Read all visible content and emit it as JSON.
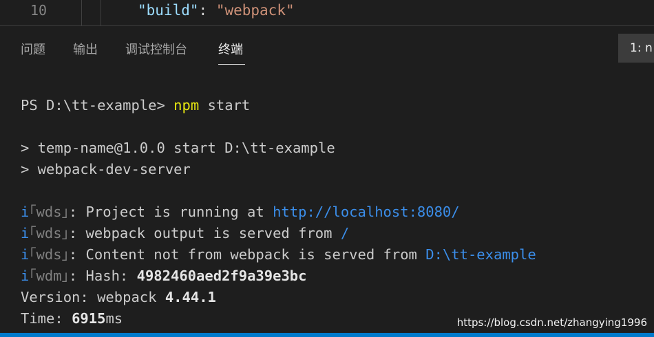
{
  "editor": {
    "line_number": "10",
    "code": {
      "key": "\"build\"",
      "colon": ": ",
      "value": "\"webpack\""
    }
  },
  "panel": {
    "tabs": [
      {
        "label": "问题"
      },
      {
        "label": "输出"
      },
      {
        "label": "调试控制台"
      },
      {
        "label": "终端",
        "active": true
      }
    ],
    "terminal_select": "1: n"
  },
  "terminal": {
    "prompt": "PS D:\\tt-example> ",
    "command": "npm",
    "command_args": " start",
    "script_line1": "> temp-name@1.0.0 start D:\\tt-example",
    "script_line2": "> webpack-dev-server",
    "wds_lines": [
      {
        "i": "i",
        "tag": "｢wds｣",
        "text": ": Project is running at ",
        "link": "http://localhost:8080/"
      },
      {
        "i": "i",
        "tag": "｢wds｣",
        "text": ": webpack output is served from ",
        "link": "/"
      },
      {
        "i": "i",
        "tag": "｢wds｣",
        "text": ": Content not from webpack is served from ",
        "link": "D:\\tt-example"
      }
    ],
    "hash_line": {
      "i": "i",
      "tag": "｢wdm｣",
      "text": ": Hash: ",
      "value": "4982460aed2f9a39e3bc"
    },
    "version_line": {
      "text": "Version: webpack ",
      "value": "4.44.1"
    },
    "time_line": {
      "text": "Time: ",
      "value": "6915",
      "unit": "ms"
    }
  },
  "watermark": "https://blog.csdn.net/zhangying1996",
  "colors": {
    "background": "#1e1e1e",
    "yellow": "#e5e510",
    "blue": "#3b8eea",
    "status_bar": "#007acc"
  }
}
